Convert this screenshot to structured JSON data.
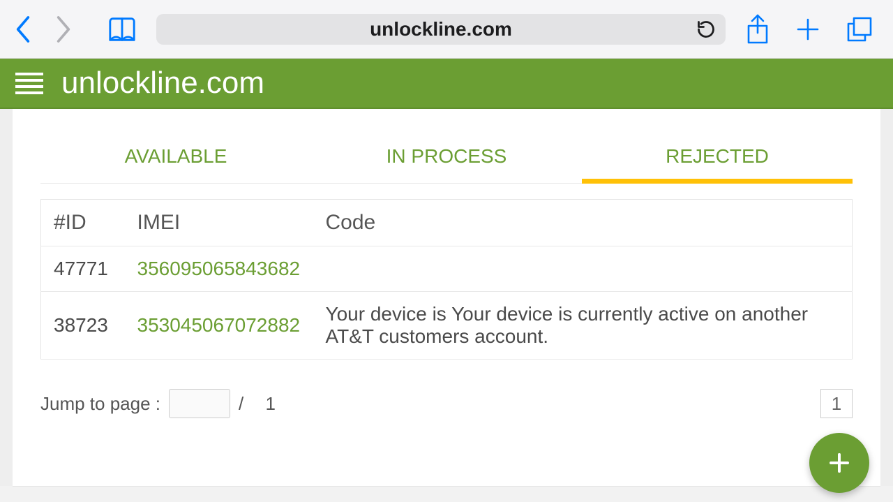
{
  "browser": {
    "address": "unlockline.com"
  },
  "header": {
    "title": "unlockline.com"
  },
  "tabs": [
    {
      "label": "AVAILABLE",
      "active": false
    },
    {
      "label": "IN PROCESS",
      "active": false
    },
    {
      "label": "REJECTED",
      "active": true
    }
  ],
  "table": {
    "headers": {
      "id": "#ID",
      "imei": "IMEI",
      "code": "Code"
    },
    "rows": [
      {
        "id": "47771",
        "imei": "356095065843682",
        "code": ""
      },
      {
        "id": "38723",
        "imei": "353045067072882",
        "code": "Your device is Your device is currently active on another AT&T customers account."
      }
    ]
  },
  "pager": {
    "label": "Jump to page :",
    "sep": "/",
    "total": "1",
    "current": "1"
  }
}
